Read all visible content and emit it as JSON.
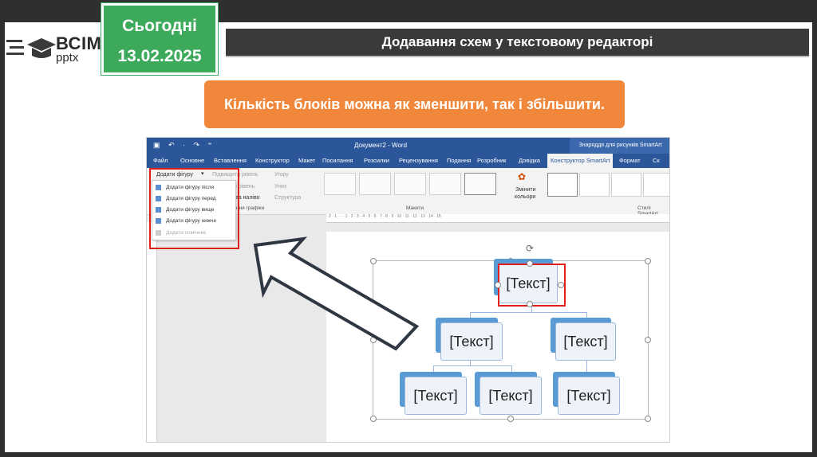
{
  "logo": {
    "main": "ВСІМ",
    "sub": "pptx"
  },
  "date_box": {
    "line1": "Сьогодні",
    "line2": "13.02.2025"
  },
  "title": "Додавання схем у текстовому редакторі",
  "callout": "Кількість блоків можна як зменшити, так і збільшити.",
  "colors": {
    "title_bg": "#3a3a3a",
    "callout_bg": "#f0873a",
    "date_bg": "#3daa5b",
    "word_blue": "#2b579a",
    "highlight_red": "#e01e1e"
  },
  "word": {
    "document_title": "Документ2 - Word",
    "context_tab_title": "Знаряддя для рисунків SmartArt",
    "tabs": [
      "Файл",
      "Основне",
      "Вставлення",
      "Конструктор",
      "Макет",
      "Посилання",
      "Розсилки",
      "Рецензування",
      "Подання",
      "Розробник",
      "Довідка",
      "Конструктор SmartArt",
      "Формат",
      "Ск"
    ],
    "active_tab": "Конструктор SmartArt",
    "ribbon": {
      "add_shape": "Додати фігуру",
      "promote": "Підвищити рівень",
      "demote": "Понизити рівень",
      "up": "Угору",
      "down": "Униз",
      "right_to_left": "справа наліво",
      "layout": "Структура",
      "group_create_graphic": "Створення графіки",
      "group_layouts": "Макети",
      "change_colors_line1": "Змінити",
      "change_colors_line2": "кольори",
      "group_styles": "Стилі SmartArt"
    },
    "dropdown": [
      {
        "label": "Додати фігуру після",
        "enabled": true
      },
      {
        "label": "Додати фігуру перед",
        "enabled": true
      },
      {
        "label": "Додати фігуру вище",
        "enabled": true
      },
      {
        "label": "Додати фігуру нижче",
        "enabled": true
      },
      {
        "label": "Додати помічник",
        "enabled": false
      }
    ],
    "ruler_text": "· 2 · 1 · · · 1 · 2 · 3 · 4 · 5 · 6 · 7 · 8 · 9 · 10 · 11 · 12 · 13 · 14 · 15",
    "nodes": {
      "top": "[Текст]",
      "mid_left": "[Текст]",
      "mid_right": "[Текст]",
      "bot_1": "[Текст]",
      "bot_2": "[Текст]",
      "bot_3": "[Текст]"
    }
  }
}
